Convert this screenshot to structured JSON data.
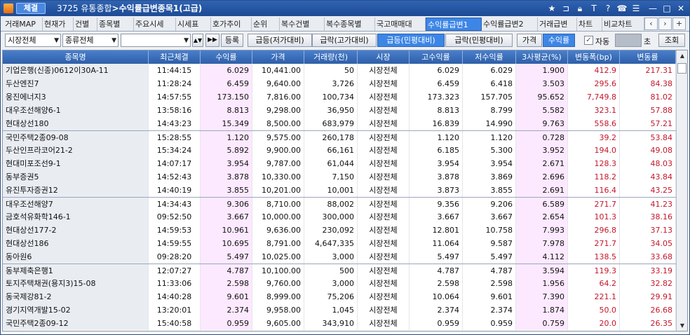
{
  "window": {
    "bind_label": "체결",
    "screen_no": "3725",
    "title_prefix": "유통종합",
    "title_main": "수익률급변종목1(고급)"
  },
  "tabs": [
    "거래MAP",
    "현재가",
    "건별",
    "종목별",
    "주요시세",
    "시세표",
    "호가추이",
    "순위",
    "복수건별",
    "복수종목별",
    "국고매매대",
    "수익률급변1",
    "수익률급변2",
    "거래급변",
    "차트",
    "비교차트"
  ],
  "active_tab": "수익률급변1",
  "filters": {
    "market": "시장전체",
    "type": "종류전체",
    "search_value": ""
  },
  "buttons": {
    "register": "등록",
    "surge_vs_prev_close": "급등(저가대비)",
    "drop_vs_high": "급락(고가대비)",
    "surge_private": "급등(민평대비)",
    "drop_private": "급락(민평대비)",
    "price": "가격",
    "yield": "수익률",
    "auto": "자동",
    "seconds": "초",
    "query": "조회"
  },
  "active_buttons": [
    "급등(민평대비)",
    "수익률"
  ],
  "auto_checked": true,
  "columns": [
    "종목명",
    "최근체결",
    "수익률",
    "가격",
    "거래량(천)",
    "시장",
    "고수익률",
    "저수익률",
    "3사평균(%)",
    "변동폭(bp)",
    "변동률"
  ],
  "rows": [
    [
      "기업은행(신종)0612이30A-11",
      "11:44:15",
      "6.029",
      "10,441.00",
      "50",
      "시장전체",
      "6.029",
      "6.029",
      "1.900",
      "412.9",
      "217.31"
    ],
    [
      "두산엔진7",
      "11:28:24",
      "6.459",
      "9,640.00",
      "3,726",
      "시장전체",
      "6.459",
      "6.418",
      "3.503",
      "295.6",
      "84.38"
    ],
    [
      "웅진에너지3",
      "14:57:55",
      "173.150",
      "7,816.00",
      "100,734",
      "시장전체",
      "173.323",
      "157.705",
      "95.652",
      "7,749.8",
      "81.02"
    ],
    [
      "대우조선해양6-1",
      "13:58:16",
      "8.813",
      "9,298.00",
      "36,950",
      "시장전체",
      "8.813",
      "8.799",
      "5.582",
      "323.1",
      "57.88"
    ],
    [
      "현대상선180",
      "14:43:23",
      "15.349",
      "8,500.00",
      "683,979",
      "시장전체",
      "16.839",
      "14.990",
      "9.763",
      "558.6",
      "57.21"
    ],
    [
      "국민주택2종09-08",
      "15:28:55",
      "1.120",
      "9,575.00",
      "260,178",
      "시장전체",
      "1.120",
      "1.120",
      "0.728",
      "39.2",
      "53.84"
    ],
    [
      "두산인프라코어21-2",
      "15:34:24",
      "5.892",
      "9,900.00",
      "66,161",
      "시장전체",
      "6.185",
      "5.300",
      "3.952",
      "194.0",
      "49.08"
    ],
    [
      "현대미포조선9-1",
      "14:07:17",
      "3.954",
      "9,787.00",
      "61,044",
      "시장전체",
      "3.954",
      "3.954",
      "2.671",
      "128.3",
      "48.03"
    ],
    [
      "동부증권5",
      "14:52:43",
      "3.878",
      "10,330.00",
      "7,150",
      "시장전체",
      "3.878",
      "3.869",
      "2.696",
      "118.2",
      "43.84"
    ],
    [
      "유진투자증권12",
      "14:40:19",
      "3.855",
      "10,201.00",
      "10,001",
      "시장전체",
      "3.873",
      "3.855",
      "2.691",
      "116.4",
      "43.25"
    ],
    [
      "대우조선해양7",
      "14:34:43",
      "9.306",
      "8,710.00",
      "88,002",
      "시장전체",
      "9.356",
      "9.206",
      "6.589",
      "271.7",
      "41.23"
    ],
    [
      "금호석유화학146-1",
      "09:52:50",
      "3.667",
      "10,000.00",
      "300,000",
      "시장전체",
      "3.667",
      "3.667",
      "2.654",
      "101.3",
      "38.16"
    ],
    [
      "현대상선177-2",
      "14:59:53",
      "10.961",
      "9,636.00",
      "230,092",
      "시장전체",
      "12.801",
      "10.758",
      "7.993",
      "296.8",
      "37.13"
    ],
    [
      "현대상선186",
      "14:59:55",
      "10.695",
      "8,791.00",
      "4,647,335",
      "시장전체",
      "11.064",
      "9.587",
      "7.978",
      "271.7",
      "34.05"
    ],
    [
      "동아원6",
      "09:28:20",
      "5.497",
      "10,025.00",
      "3,000",
      "시장전체",
      "5.497",
      "5.497",
      "4.112",
      "138.5",
      "33.68"
    ],
    [
      "동부제축은행1",
      "12:07:27",
      "4.787",
      "10,100.00",
      "500",
      "시장전체",
      "4.787",
      "4.787",
      "3.594",
      "119.3",
      "33.19"
    ],
    [
      "토지주택채권(용지3)15-08",
      "11:33:06",
      "2.598",
      "9,760.00",
      "3,000",
      "시장전체",
      "2.598",
      "2.598",
      "1.956",
      "64.2",
      "32.82"
    ],
    [
      "동국제강81-2",
      "14:40:28",
      "9.601",
      "8,999.00",
      "75,206",
      "시장전체",
      "10.064",
      "9.601",
      "7.390",
      "221.1",
      "29.91"
    ],
    [
      "경기지역개발15-02",
      "13:20:01",
      "2.374",
      "9,958.00",
      "1,045",
      "시장전체",
      "2.374",
      "2.374",
      "1.874",
      "50.0",
      "26.68"
    ],
    [
      "국민주택2종09-12",
      "15:40:58",
      "0.959",
      "9,605.00",
      "343,910",
      "시장전체",
      "0.959",
      "0.959",
      "0.759",
      "20.0",
      "26.35"
    ]
  ],
  "colors": {
    "accent": "#3d86e6",
    "title_bar": "#1d4a94",
    "header": "#2e5fa8",
    "yield_col_bg": "#fde9ff",
    "name_col_bg": "#e9edf2",
    "change_text": "#c4162a"
  },
  "icons": {
    "title": [
      "star-icon",
      "pin-icon",
      "lock-icon",
      "text-icon",
      "help-icon",
      "phone-icon",
      "menu-icon",
      "minimize-icon",
      "maximize-icon",
      "close-icon"
    ]
  }
}
